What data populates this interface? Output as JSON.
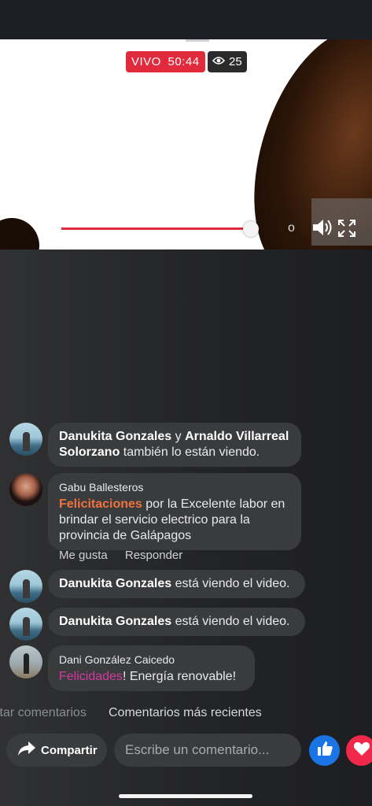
{
  "video": {
    "live_label": "VIVO",
    "live_time": "50:44",
    "viewer_count": "25",
    "progress": 0.95,
    "partial_control_text": "o"
  },
  "comments": [
    {
      "type": "viewing",
      "name1": "Danukita Gonzales",
      "connector": "y",
      "name2": "Arnaldo Villarreal Solorzano",
      "text": "también lo están viendo."
    },
    {
      "type": "comment",
      "author": "Gabu Ballesteros",
      "highlight": "Felicitaciones",
      "text": "por la Excelente labor en brindar el servicio electrico para la provincia de Galápagos",
      "actions": [
        "Me gusta",
        "Responder"
      ]
    },
    {
      "type": "viewing",
      "name": "Danukita Gonzales",
      "text": "está viendo el video."
    },
    {
      "type": "viewing",
      "name": "Danukita Gonzales",
      "text": "está viendo el video."
    },
    {
      "type": "comment",
      "author": "Dani González Caicedo",
      "highlight": "Felicidades",
      "text": "! Energía renovable!"
    }
  ],
  "sort": {
    "inactive": "ltar comentarios",
    "active": "Comentarios más recientes"
  },
  "composer": {
    "share_label": "Compartir",
    "placeholder": "Escribe un comentario..."
  },
  "colors": {
    "live_red": "#e22a3d",
    "like_blue": "#1b74e4",
    "love_red": "#f0284a",
    "highlight_orange": "#f0723e",
    "highlight_pink": "#d43aa0"
  },
  "icons": [
    "eye-icon",
    "volume-icon",
    "fullscreen-icon",
    "share-arrow-icon",
    "thumbs-up-icon",
    "heart-icon"
  ]
}
